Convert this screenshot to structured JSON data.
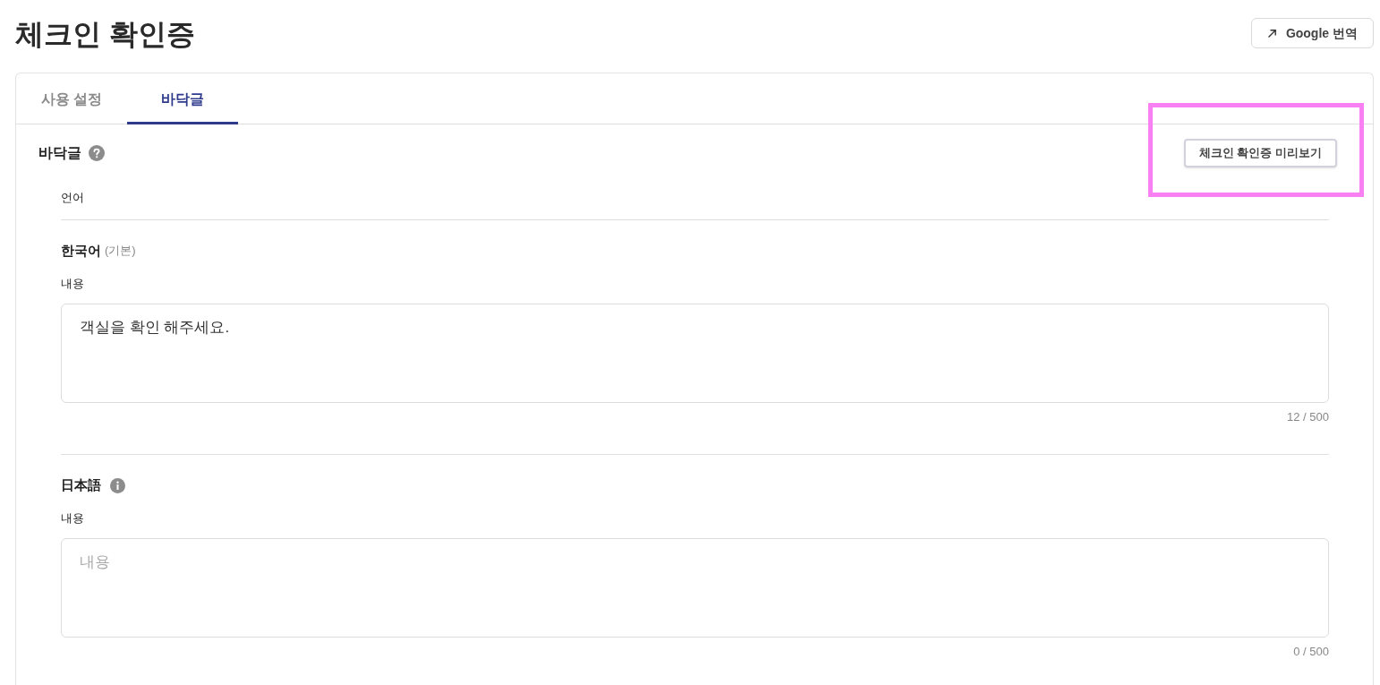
{
  "page": {
    "title": "체크인 확인증"
  },
  "translate_button": {
    "label": "Google 번역"
  },
  "tabs": [
    {
      "label": "사용 설정",
      "selected": false
    },
    {
      "label": "바닥글",
      "selected": true
    }
  ],
  "section": {
    "title": "바닥글",
    "preview_button": {
      "label": "체크인 확인증 미리보기",
      "highlighted": true
    },
    "language_label": "언어",
    "languages": [
      {
        "name": "한국어",
        "note": "(기본)",
        "info_icon": false,
        "content_label": "내용",
        "value": "객실을 확인 해주세요.",
        "counter": "12 / 500"
      },
      {
        "name": "日本語",
        "info_icon": true,
        "content_label": "내용",
        "placeholder": "내용",
        "counter": "0 / 500"
      }
    ]
  }
}
